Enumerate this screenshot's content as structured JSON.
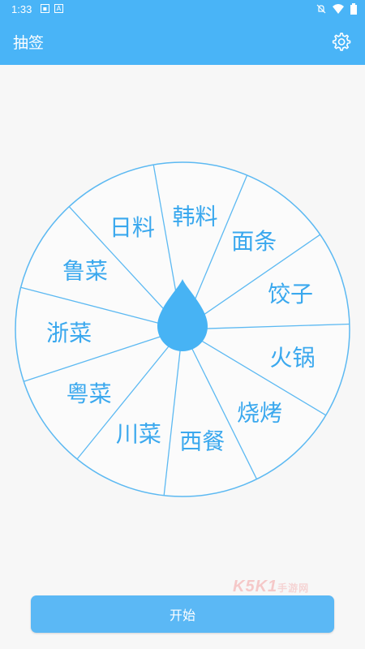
{
  "status_bar": {
    "time": "1:33",
    "left_icons": [
      "image-icon",
      "a-icon"
    ],
    "right_icons": [
      "bell-off-icon",
      "wifi-icon",
      "battery-icon"
    ]
  },
  "app_bar": {
    "title": "抽签",
    "settings_icon": "gear-icon",
    "color": "#49b4f7"
  },
  "wheel": {
    "items": [
      "韩料",
      "面条",
      "饺子",
      "火锅",
      "烧烤",
      "西餐",
      "川菜",
      "粤菜",
      "浙菜",
      "鲁菜",
      "日料"
    ],
    "line_color": "#5cb9f2",
    "text_color": "#3aa8ee",
    "pointer_color": "#47b3f4"
  },
  "start_button": {
    "label": "开始",
    "color": "#5bb8f5"
  },
  "watermark": {
    "text": "K5K1",
    "suffix": "手游网"
  }
}
